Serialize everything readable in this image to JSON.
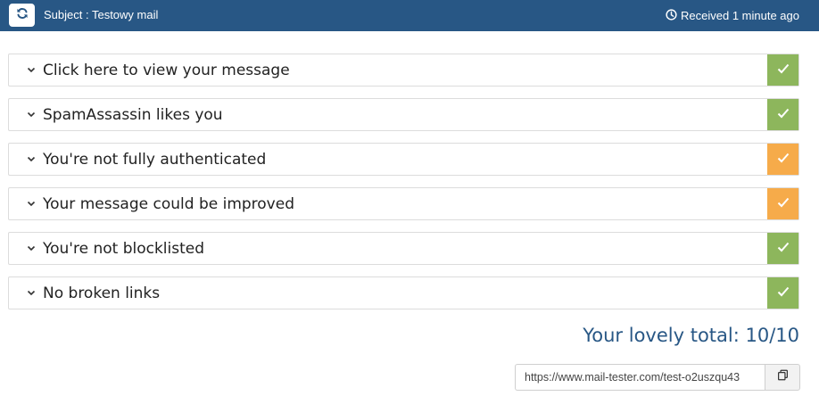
{
  "header": {
    "refresh_icon": "refresh-icon",
    "subject": "Subject : Testowy mail",
    "clock_icon": "clock-icon",
    "received": "Received 1 minute ago",
    "background": "#285785"
  },
  "results": [
    {
      "title": "Click here to view your message",
      "status": "ok",
      "status_color": "#8db65c"
    },
    {
      "title": "SpamAssassin likes you",
      "status": "ok",
      "status_color": "#8db65c"
    },
    {
      "title": "You're not fully authenticated",
      "status": "warning",
      "status_color": "#f6ab4a"
    },
    {
      "title": "Your message could be improved",
      "status": "warning",
      "status_color": "#f6ab4a"
    },
    {
      "title": "You're not blocklisted",
      "status": "ok",
      "status_color": "#8db65c"
    },
    {
      "title": "No broken links",
      "status": "ok",
      "status_color": "#8db65c"
    }
  ],
  "summary": {
    "total_text": "Your lovely total: 10/10",
    "link_value": "https://www.mail-tester.com/test-o2uszqu43",
    "copy_icon": "copy-icon"
  }
}
